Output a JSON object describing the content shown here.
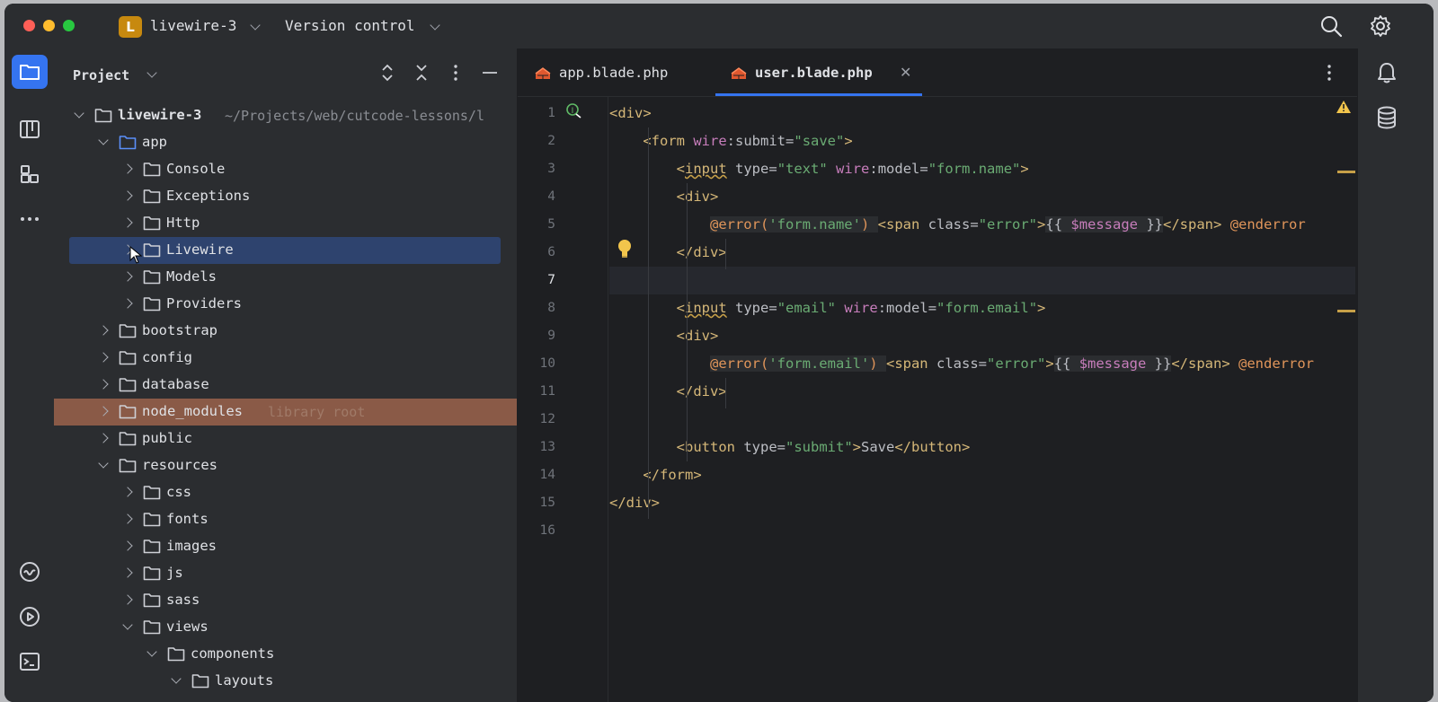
{
  "titlebar": {
    "project_badge": "L",
    "project_name": "livewire-3",
    "vcs_label": "Version control"
  },
  "project_panel": {
    "title": "Project",
    "tree": [
      {
        "label": "livewire-3",
        "hint": "~/Projects/web/cutcode-lessons/l",
        "depth": 0,
        "open": true,
        "bold": true
      },
      {
        "label": "app",
        "depth": 1,
        "open": true,
        "accent": true
      },
      {
        "label": "Console",
        "depth": 2,
        "open": false
      },
      {
        "label": "Exceptions",
        "depth": 2,
        "open": false
      },
      {
        "label": "Http",
        "depth": 2,
        "open": false
      },
      {
        "label": "Livewire",
        "depth": 2,
        "open": false,
        "selected": true
      },
      {
        "label": "Models",
        "depth": 2,
        "open": false
      },
      {
        "label": "Providers",
        "depth": 2,
        "open": false
      },
      {
        "label": "bootstrap",
        "depth": 1,
        "open": false
      },
      {
        "label": "config",
        "depth": 1,
        "open": false
      },
      {
        "label": "database",
        "depth": 1,
        "open": false
      },
      {
        "label": "node_modules",
        "hint": "library root",
        "depth": 1,
        "open": false,
        "library": true
      },
      {
        "label": "public",
        "depth": 1,
        "open": false
      },
      {
        "label": "resources",
        "depth": 1,
        "open": true
      },
      {
        "label": "css",
        "depth": 2,
        "open": false
      },
      {
        "label": "fonts",
        "depth": 2,
        "open": false
      },
      {
        "label": "images",
        "depth": 2,
        "open": false
      },
      {
        "label": "js",
        "depth": 2,
        "open": false
      },
      {
        "label": "sass",
        "depth": 2,
        "open": false
      },
      {
        "label": "views",
        "depth": 2,
        "open": true
      },
      {
        "label": "components",
        "depth": 3,
        "open": true
      },
      {
        "label": "layouts",
        "depth": 4,
        "open": true
      }
    ]
  },
  "editor": {
    "tabs": [
      {
        "label": "app.blade.php",
        "active": false
      },
      {
        "label": "user.blade.php",
        "active": true
      }
    ],
    "current_line": 7,
    "lines": [
      {
        "n": "1",
        "html": "<span class=\"tag\">&lt;div&gt;</span>"
      },
      {
        "n": "2",
        "html": "    <span class=\"tag\">&lt;form</span> <span class=\"ns\">wire</span>:<span class=\"attr\">submit</span>=<span class=\"str\">\"save\"</span><span class=\"tag\">&gt;</span>"
      },
      {
        "n": "3",
        "html": "        <span class=\"tag\">&lt;<span class=\"warn-u\">input</span></span> <span class=\"attr\">type</span>=<span class=\"str\">\"text\"</span> <span class=\"ns\">wire</span>:<span class=\"attr\">model</span>=<span class=\"str\">\"form.name\"</span><span class=\"tag\">&gt;</span>"
      },
      {
        "n": "4",
        "html": "        <span class=\"tag\">&lt;div&gt;</span>"
      },
      {
        "n": "5",
        "html": "            <span class=\"blk\"><span class=\"dir\">@error(</span><span class=\"str\">'form.name'</span><span class=\"dir\">)</span> </span><span class=\"tag\">&lt;span</span> <span class=\"attr\">class</span>=<span class=\"str\">\"error\"</span><span class=\"tag\">&gt;</span><span class=\"blk\">{{ <span class=\"var\">$message</span> }}</span><span class=\"tag\">&lt;/span&gt;</span> <span class=\"dir\">@enderror</span>"
      },
      {
        "n": "6",
        "html": "        <span class=\"tag\">&lt;/div&gt;</span>"
      },
      {
        "n": "7",
        "html": ""
      },
      {
        "n": "8",
        "html": "        <span class=\"tag\">&lt;<span class=\"warn-u\">input</span></span> <span class=\"attr\">type</span>=<span class=\"str\">\"email\"</span> <span class=\"ns\">wire</span>:<span class=\"attr\">model</span>=<span class=\"str\">\"form.email\"</span><span class=\"tag\">&gt;</span>"
      },
      {
        "n": "9",
        "html": "        <span class=\"tag\">&lt;div&gt;</span>"
      },
      {
        "n": "10",
        "html": "            <span class=\"blk\"><span class=\"dir\">@error(</span><span class=\"str\">'form.email'</span><span class=\"dir\">)</span> </span><span class=\"tag\">&lt;span</span> <span class=\"attr\">class</span>=<span class=\"str\">\"error\"</span><span class=\"tag\">&gt;</span><span class=\"blk\">{{ <span class=\"var\">$message</span> }}</span><span class=\"tag\">&lt;/span&gt;</span> <span class=\"dir\">@enderror</span>"
      },
      {
        "n": "11",
        "html": "        <span class=\"tag\">&lt;/div&gt;</span>"
      },
      {
        "n": "12",
        "html": ""
      },
      {
        "n": "13",
        "html": "        <span class=\"tag\">&lt;button</span> <span class=\"attr\">type</span>=<span class=\"str\">\"submit\"</span><span class=\"tag\">&gt;</span>Save<span class=\"tag\">&lt;/button&gt;</span>"
      },
      {
        "n": "14",
        "html": "    <span class=\"tag\">&lt;/form&gt;</span>"
      },
      {
        "n": "15",
        "html": "<span class=\"tag\">&lt;/div&gt;</span>"
      },
      {
        "n": "16",
        "html": ""
      }
    ]
  },
  "icons": {
    "left_toolbar": [
      "project-folder-icon",
      "structure-icon",
      "plugins-icon",
      "more-icon",
      "services-icon",
      "run-icon",
      "terminal-icon"
    ],
    "right_toolbar": [
      "notifications-icon",
      "database-icon"
    ]
  },
  "colors": {
    "accent": "#3574f0",
    "selection": "#2e436e",
    "library_root": "#8a5a47",
    "badge": "#c7890f"
  }
}
